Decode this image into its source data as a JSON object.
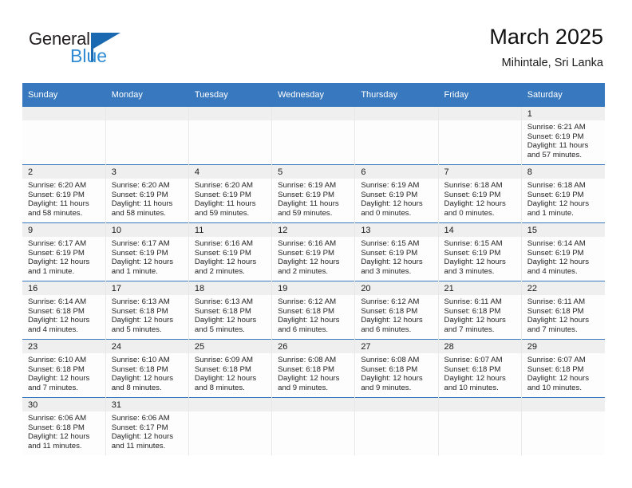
{
  "brand": {
    "name_dark": "General",
    "name_blue": "Blue",
    "accent_blue": "#3778be",
    "logo_blue": "#2e8bd4"
  },
  "header": {
    "month_title": "March 2025",
    "location": "Mihintale, Sri Lanka"
  },
  "weekday_headers": [
    "Sunday",
    "Monday",
    "Tuesday",
    "Wednesday",
    "Thursday",
    "Friday",
    "Saturday"
  ],
  "labels": {
    "sunrise_prefix": "Sunrise:",
    "sunset_prefix": "Sunset:",
    "daylight_prefix": "Daylight:"
  },
  "weeks": [
    [
      {
        "day": "",
        "lines": []
      },
      {
        "day": "",
        "lines": []
      },
      {
        "day": "",
        "lines": []
      },
      {
        "day": "",
        "lines": []
      },
      {
        "day": "",
        "lines": []
      },
      {
        "day": "",
        "lines": []
      },
      {
        "day": "1",
        "lines": [
          "Sunrise: 6:21 AM",
          "Sunset: 6:19 PM",
          "Daylight: 11 hours",
          "and 57 minutes."
        ]
      }
    ],
    [
      {
        "day": "2",
        "lines": [
          "Sunrise: 6:20 AM",
          "Sunset: 6:19 PM",
          "Daylight: 11 hours",
          "and 58 minutes."
        ]
      },
      {
        "day": "3",
        "lines": [
          "Sunrise: 6:20 AM",
          "Sunset: 6:19 PM",
          "Daylight: 11 hours",
          "and 58 minutes."
        ]
      },
      {
        "day": "4",
        "lines": [
          "Sunrise: 6:20 AM",
          "Sunset: 6:19 PM",
          "Daylight: 11 hours",
          "and 59 minutes."
        ]
      },
      {
        "day": "5",
        "lines": [
          "Sunrise: 6:19 AM",
          "Sunset: 6:19 PM",
          "Daylight: 11 hours",
          "and 59 minutes."
        ]
      },
      {
        "day": "6",
        "lines": [
          "Sunrise: 6:19 AM",
          "Sunset: 6:19 PM",
          "Daylight: 12 hours",
          "and 0 minutes."
        ]
      },
      {
        "day": "7",
        "lines": [
          "Sunrise: 6:18 AM",
          "Sunset: 6:19 PM",
          "Daylight: 12 hours",
          "and 0 minutes."
        ]
      },
      {
        "day": "8",
        "lines": [
          "Sunrise: 6:18 AM",
          "Sunset: 6:19 PM",
          "Daylight: 12 hours",
          "and 1 minute."
        ]
      }
    ],
    [
      {
        "day": "9",
        "lines": [
          "Sunrise: 6:17 AM",
          "Sunset: 6:19 PM",
          "Daylight: 12 hours",
          "and 1 minute."
        ]
      },
      {
        "day": "10",
        "lines": [
          "Sunrise: 6:17 AM",
          "Sunset: 6:19 PM",
          "Daylight: 12 hours",
          "and 1 minute."
        ]
      },
      {
        "day": "11",
        "lines": [
          "Sunrise: 6:16 AM",
          "Sunset: 6:19 PM",
          "Daylight: 12 hours",
          "and 2 minutes."
        ]
      },
      {
        "day": "12",
        "lines": [
          "Sunrise: 6:16 AM",
          "Sunset: 6:19 PM",
          "Daylight: 12 hours",
          "and 2 minutes."
        ]
      },
      {
        "day": "13",
        "lines": [
          "Sunrise: 6:15 AM",
          "Sunset: 6:19 PM",
          "Daylight: 12 hours",
          "and 3 minutes."
        ]
      },
      {
        "day": "14",
        "lines": [
          "Sunrise: 6:15 AM",
          "Sunset: 6:19 PM",
          "Daylight: 12 hours",
          "and 3 minutes."
        ]
      },
      {
        "day": "15",
        "lines": [
          "Sunrise: 6:14 AM",
          "Sunset: 6:19 PM",
          "Daylight: 12 hours",
          "and 4 minutes."
        ]
      }
    ],
    [
      {
        "day": "16",
        "lines": [
          "Sunrise: 6:14 AM",
          "Sunset: 6:18 PM",
          "Daylight: 12 hours",
          "and 4 minutes."
        ]
      },
      {
        "day": "17",
        "lines": [
          "Sunrise: 6:13 AM",
          "Sunset: 6:18 PM",
          "Daylight: 12 hours",
          "and 5 minutes."
        ]
      },
      {
        "day": "18",
        "lines": [
          "Sunrise: 6:13 AM",
          "Sunset: 6:18 PM",
          "Daylight: 12 hours",
          "and 5 minutes."
        ]
      },
      {
        "day": "19",
        "lines": [
          "Sunrise: 6:12 AM",
          "Sunset: 6:18 PM",
          "Daylight: 12 hours",
          "and 6 minutes."
        ]
      },
      {
        "day": "20",
        "lines": [
          "Sunrise: 6:12 AM",
          "Sunset: 6:18 PM",
          "Daylight: 12 hours",
          "and 6 minutes."
        ]
      },
      {
        "day": "21",
        "lines": [
          "Sunrise: 6:11 AM",
          "Sunset: 6:18 PM",
          "Daylight: 12 hours",
          "and 7 minutes."
        ]
      },
      {
        "day": "22",
        "lines": [
          "Sunrise: 6:11 AM",
          "Sunset: 6:18 PM",
          "Daylight: 12 hours",
          "and 7 minutes."
        ]
      }
    ],
    [
      {
        "day": "23",
        "lines": [
          "Sunrise: 6:10 AM",
          "Sunset: 6:18 PM",
          "Daylight: 12 hours",
          "and 7 minutes."
        ]
      },
      {
        "day": "24",
        "lines": [
          "Sunrise: 6:10 AM",
          "Sunset: 6:18 PM",
          "Daylight: 12 hours",
          "and 8 minutes."
        ]
      },
      {
        "day": "25",
        "lines": [
          "Sunrise: 6:09 AM",
          "Sunset: 6:18 PM",
          "Daylight: 12 hours",
          "and 8 minutes."
        ]
      },
      {
        "day": "26",
        "lines": [
          "Sunrise: 6:08 AM",
          "Sunset: 6:18 PM",
          "Daylight: 12 hours",
          "and 9 minutes."
        ]
      },
      {
        "day": "27",
        "lines": [
          "Sunrise: 6:08 AM",
          "Sunset: 6:18 PM",
          "Daylight: 12 hours",
          "and 9 minutes."
        ]
      },
      {
        "day": "28",
        "lines": [
          "Sunrise: 6:07 AM",
          "Sunset: 6:18 PM",
          "Daylight: 12 hours",
          "and 10 minutes."
        ]
      },
      {
        "day": "29",
        "lines": [
          "Sunrise: 6:07 AM",
          "Sunset: 6:18 PM",
          "Daylight: 12 hours",
          "and 10 minutes."
        ]
      }
    ],
    [
      {
        "day": "30",
        "lines": [
          "Sunrise: 6:06 AM",
          "Sunset: 6:18 PM",
          "Daylight: 12 hours",
          "and 11 minutes."
        ]
      },
      {
        "day": "31",
        "lines": [
          "Sunrise: 6:06 AM",
          "Sunset: 6:17 PM",
          "Daylight: 12 hours",
          "and 11 minutes."
        ]
      },
      {
        "day": "",
        "lines": []
      },
      {
        "day": "",
        "lines": []
      },
      {
        "day": "",
        "lines": []
      },
      {
        "day": "",
        "lines": []
      },
      {
        "day": "",
        "lines": []
      }
    ]
  ]
}
